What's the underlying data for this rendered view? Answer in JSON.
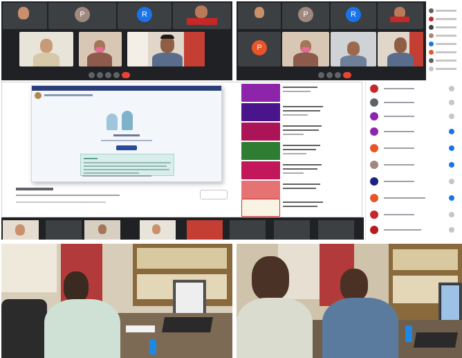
{
  "panels": {
    "top_left_call": {
      "avatar_letters": [
        "P",
        "R"
      ]
    },
    "top_right_call": {
      "avatar_letters": [
        "P",
        "R",
        "P"
      ]
    },
    "portal_screen": {},
    "bottom_left_photo": {},
    "bottom_right_photo": {}
  },
  "colors": {
    "meet_dark": "#202124",
    "meet_tile": "#3c4043",
    "end_call_red": "#ea4335",
    "avatar_brown": "#a1887f",
    "avatar_blue": "#1a73e8",
    "avatar_orange": "#e8552b"
  }
}
